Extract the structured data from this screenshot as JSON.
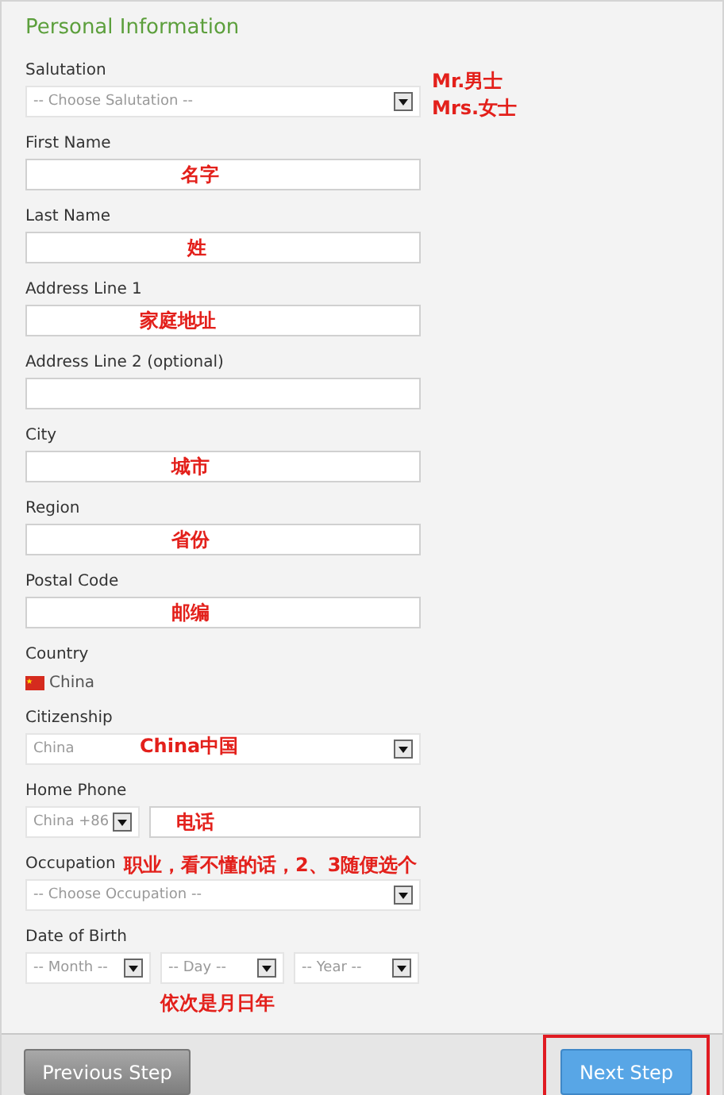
{
  "section_title": "Personal Information",
  "fields": [
    {
      "kind": "select",
      "label": "Salutation",
      "value": "-- Choose Salutation --",
      "note": [
        "Mr.男士",
        "Mrs.女士"
      ]
    },
    {
      "kind": "text",
      "label": "First Name",
      "note": [
        "名字"
      ]
    },
    {
      "kind": "text",
      "label": "Last Name",
      "note": [
        "姓"
      ]
    },
    {
      "kind": "text",
      "label": "Address Line 1",
      "note": [
        "家庭地址"
      ]
    },
    {
      "kind": "text",
      "label": "Address Line 2 (optional)"
    },
    {
      "kind": "text",
      "label": "City",
      "note": [
        "城市"
      ]
    },
    {
      "kind": "text",
      "label": "Region",
      "note": [
        "省份"
      ]
    },
    {
      "kind": "text",
      "label": "Postal Code",
      "note": [
        "邮编"
      ]
    },
    {
      "kind": "static",
      "label": "Country",
      "value": "China"
    },
    {
      "kind": "select",
      "label": "Citizenship",
      "value": "China",
      "note": [
        "China中国"
      ]
    },
    {
      "kind": "phone",
      "label": "Home Phone",
      "value": "China +86",
      "note": [
        "电话"
      ]
    },
    {
      "kind": "select",
      "label": "Occupation",
      "value": "-- Choose Occupation --",
      "note": [
        "职业，看不懂的话，2、3随便选个"
      ]
    },
    {
      "kind": "date",
      "label": "Date of Birth",
      "parts": [
        "-- Month --",
        "-- Day --",
        "-- Year --"
      ],
      "note": [
        "依次是月日年"
      ]
    }
  ],
  "buttons": [
    {
      "kind": "secondary",
      "label": "Previous Step",
      "highlighted": false
    },
    {
      "kind": "primary",
      "label": "Next Step",
      "highlighted": true
    }
  ]
}
